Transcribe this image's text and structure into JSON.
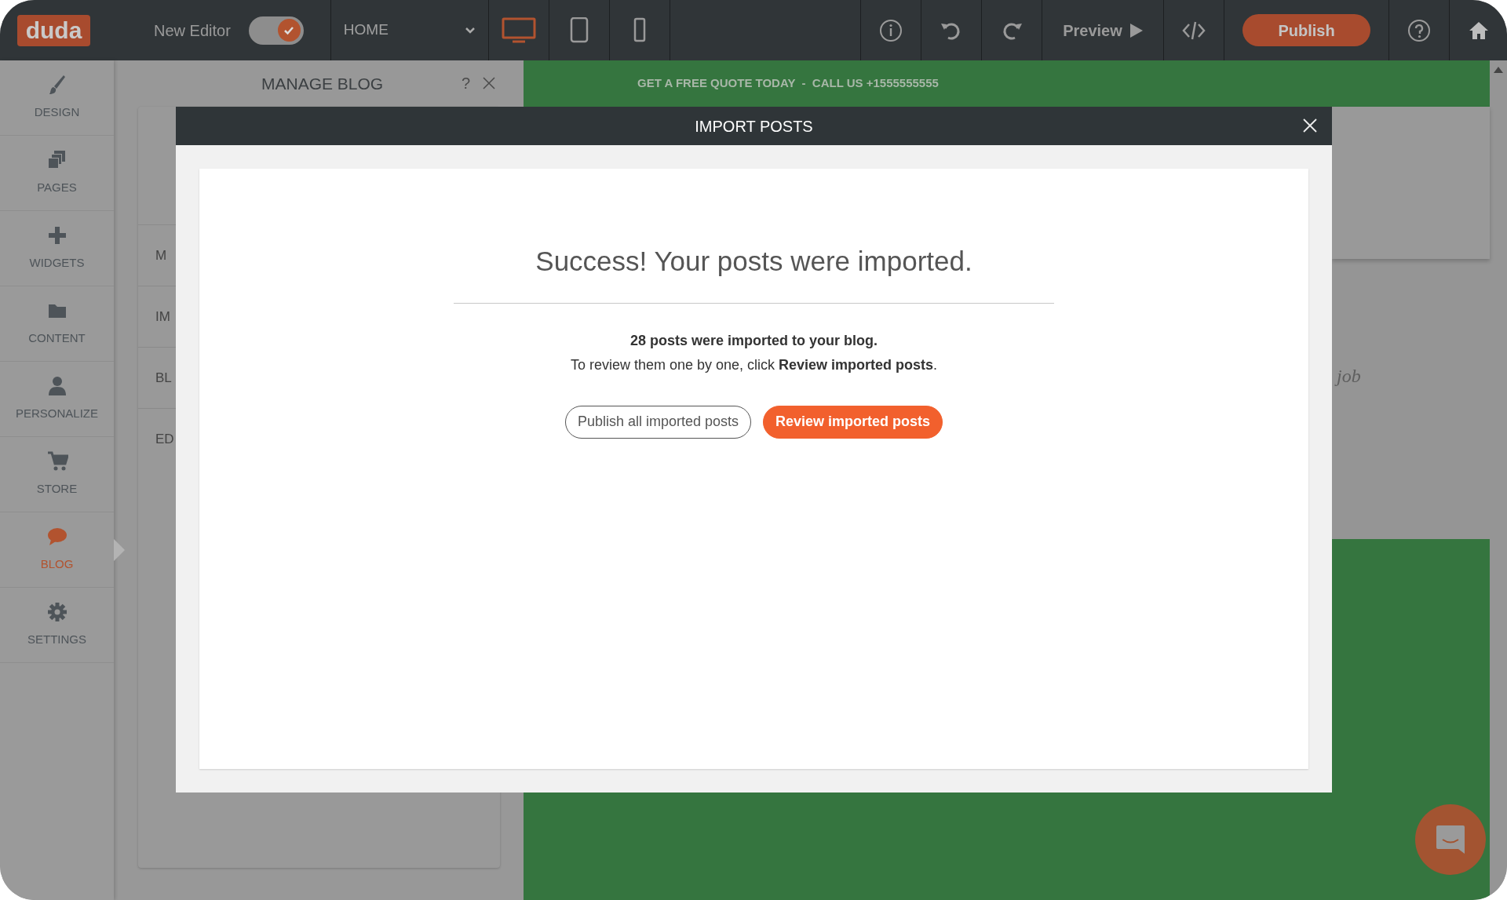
{
  "top_bar": {
    "logo": "duda",
    "new_editor": {
      "label": "New Editor",
      "on": true
    },
    "page_select": "HOME",
    "devices": [
      {
        "kind": "desktop",
        "selected": true
      },
      {
        "kind": "tablet",
        "selected": false
      },
      {
        "kind": "phone",
        "selected": false
      }
    ],
    "preview": "Preview",
    "publish": "Publish"
  },
  "sidebar": {
    "items": [
      {
        "label": "DESIGN",
        "kind": "brush",
        "selected": false
      },
      {
        "label": "PAGES",
        "kind": "pages",
        "selected": false
      },
      {
        "label": "WIDGETS",
        "kind": "plus",
        "selected": false
      },
      {
        "label": "CONTENT",
        "kind": "folder",
        "selected": false
      },
      {
        "label": "PERSONALIZE",
        "kind": "person",
        "selected": false
      },
      {
        "label": "STORE",
        "kind": "cart",
        "selected": false
      },
      {
        "label": "BLOG",
        "kind": "bubble",
        "selected": true
      },
      {
        "label": "SETTINGS",
        "kind": "gear",
        "selected": false
      }
    ]
  },
  "manage_blog": {
    "title": "MANAGE BLOG",
    "help": "?",
    "rows": [
      "M",
      "IM",
      "BL",
      "ED"
    ]
  },
  "site": {
    "banner": "GET A FREE QUOTE TODAY  -  CALL US +1555555555",
    "fragment": "job"
  },
  "modal": {
    "title": "IMPORT POSTS",
    "heading": "Success! Your posts were imported.",
    "message": "28 posts were imported to your blog.",
    "instruction": "To review them one by one, click **Review imported posts**.",
    "buttons": [
      {
        "label": "Publish all imported posts",
        "kind": "outline"
      },
      {
        "label": "Review imported posts",
        "kind": "primary"
      }
    ]
  }
}
